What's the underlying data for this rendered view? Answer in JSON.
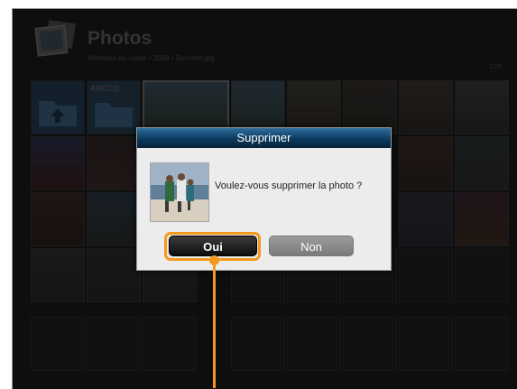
{
  "header": {
    "title": "Photos",
    "breadcrumb": "Mémoire du cadre • 2009 • Summer.jpg",
    "counter": "1/25",
    "folder_label": "ABCDE"
  },
  "dialog": {
    "title": "Supprimer",
    "message": "Voulez-vous supprimer la photo ?",
    "confirm_label": "Oui",
    "cancel_label": "Non"
  },
  "colors": {
    "accent_callout": "#f39a1e",
    "dialog_title_bar": "#0c3a5e",
    "background": "#1b1b1b"
  },
  "icons": {
    "app": "photos-stack-icon",
    "folder_up": "folder-up-icon"
  }
}
